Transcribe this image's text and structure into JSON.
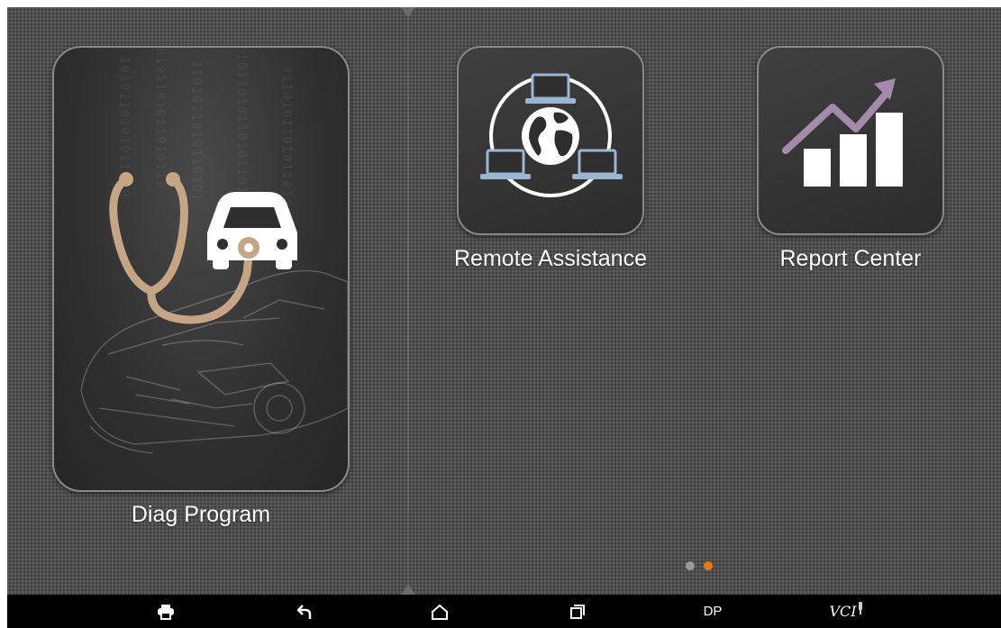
{
  "apps": [
    {
      "label": "Diag Program",
      "icon": "stethoscope-car-icon"
    },
    {
      "label": "Remote Assistance",
      "icon": "network-globe-icon"
    },
    {
      "label": "Report Center",
      "icon": "growth-chart-icon"
    }
  ],
  "pager": {
    "page_count": 2,
    "active_page": 2,
    "active_color": "#e77817",
    "inactive_color": "#9a9a9a"
  },
  "navbar": {
    "items": [
      {
        "icon": "print-icon"
      },
      {
        "icon": "back-icon"
      },
      {
        "icon": "home-icon"
      },
      {
        "icon": "recent-apps-icon"
      },
      {
        "label": "DP"
      },
      {
        "label": "VCI",
        "icon": "vci-status-icon"
      }
    ]
  },
  "colors": {
    "background": "#4e4e4e",
    "stethoscope": "#c5a583",
    "chart_arrow": "#a68aab",
    "laptop": "#9bb6d2"
  }
}
